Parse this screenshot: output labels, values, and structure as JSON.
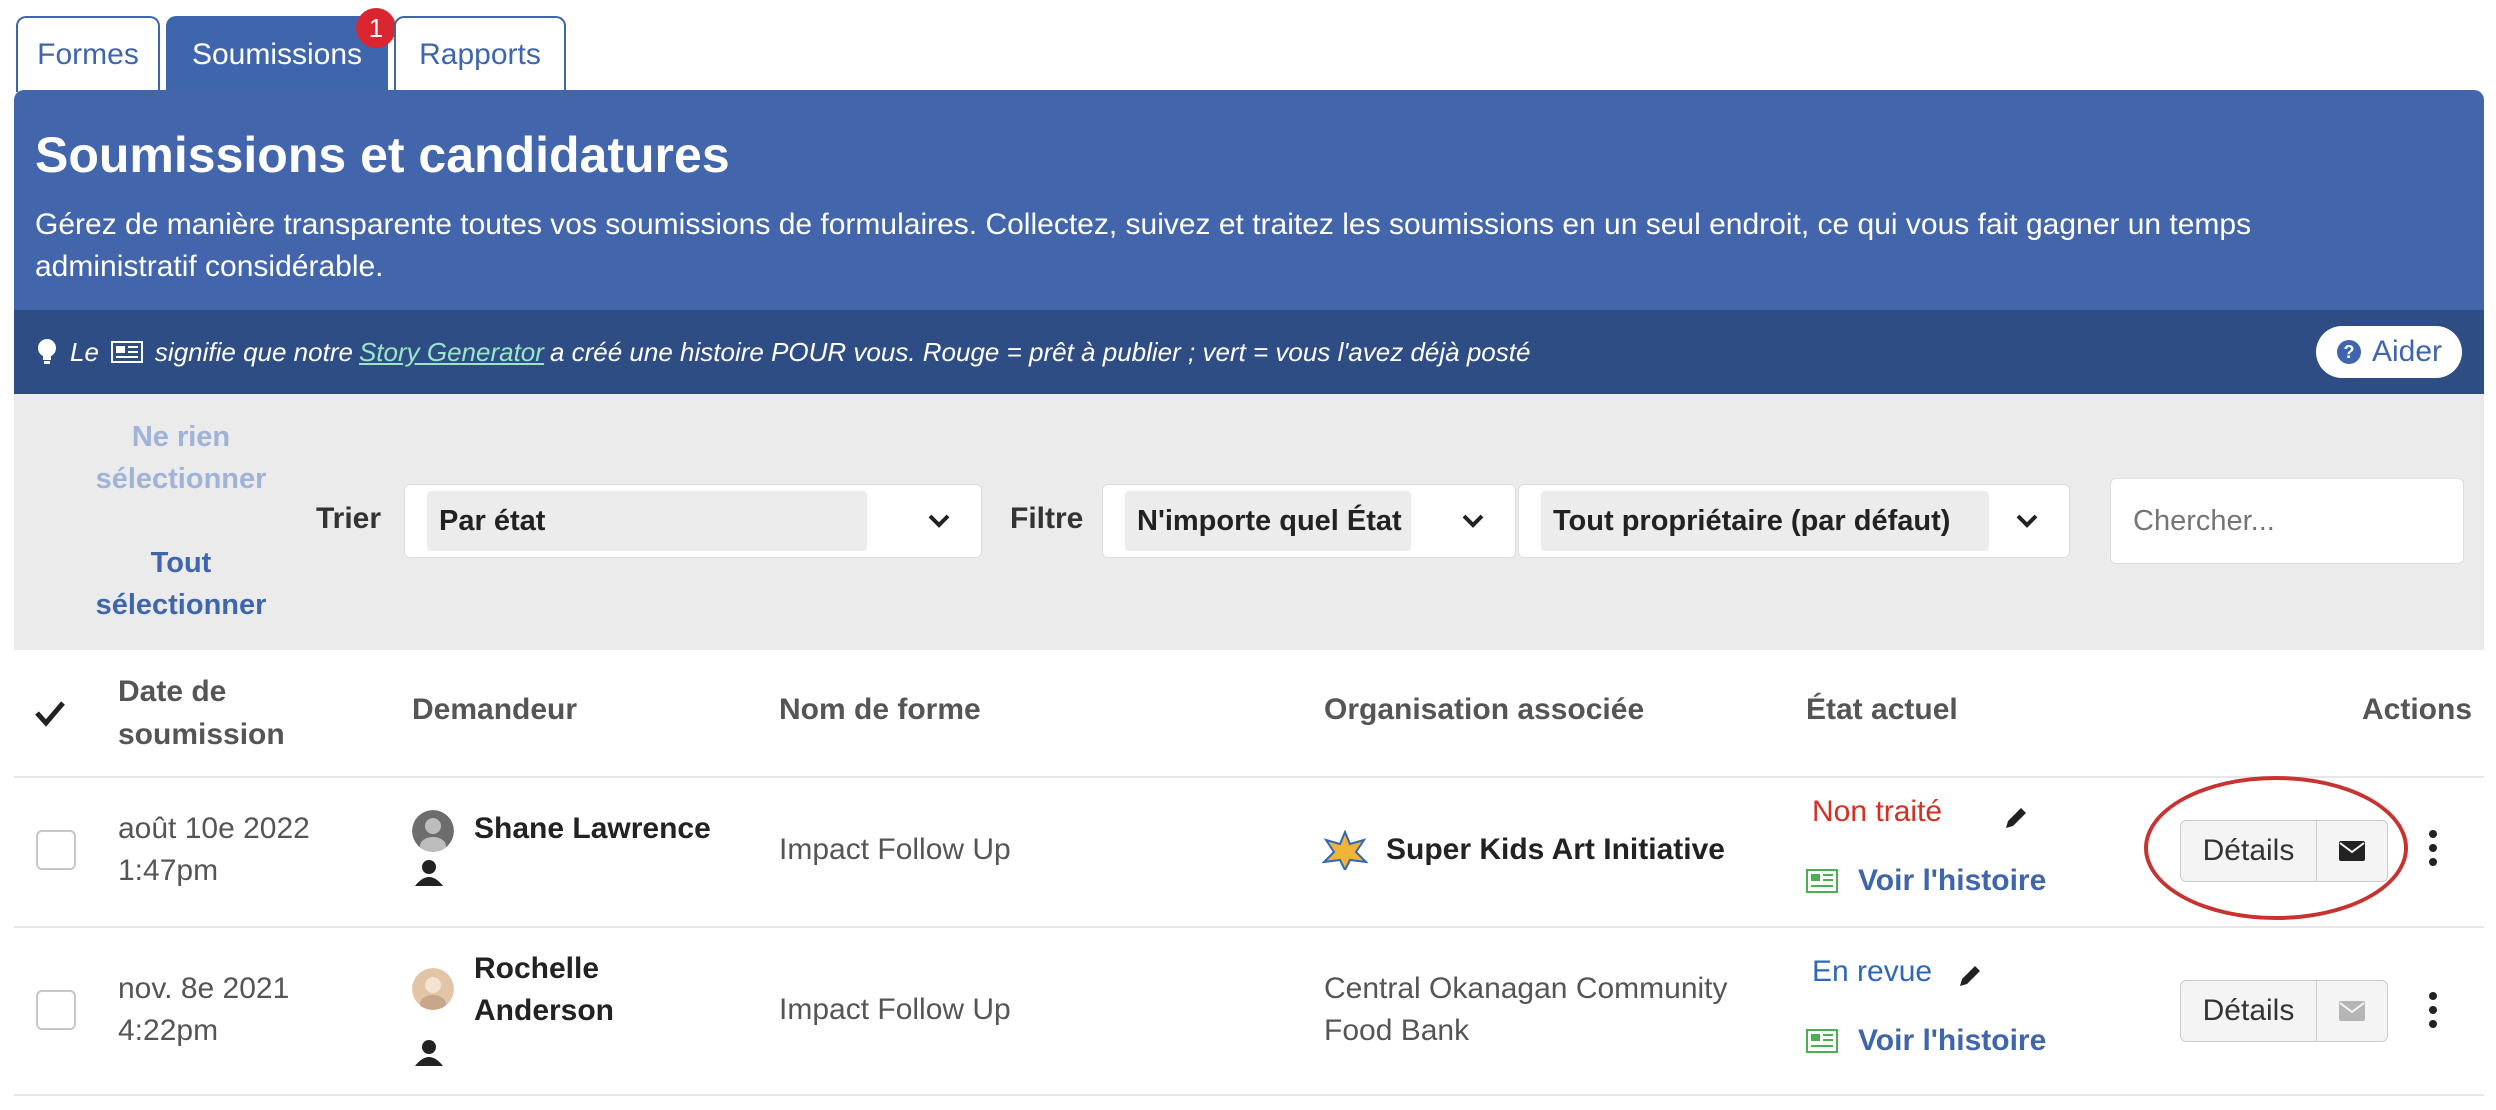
{
  "tabs": [
    {
      "label": "Formes"
    },
    {
      "label": "Soumissions",
      "badge": "1"
    },
    {
      "label": "Rapports"
    }
  ],
  "header": {
    "title": "Soumissions et candidatures",
    "description": "Gérez de manière transparente toutes vos soumissions de formulaires. Collectez, suivez et traitez les soumissions en un seul endroit, ce qui vous fait gagner un temps administratif considérable."
  },
  "tip": {
    "prefix": "Le",
    "middle": "signifie que notre",
    "link": "Story Generator",
    "suffix": "a créé une histoire POUR vous. Rouge = prêt à publier ; vert = vous l'avez déjà posté",
    "help_label": "Aider"
  },
  "filters": {
    "select_none": "Ne rien sélectionner",
    "select_all": "Tout sélectionner",
    "sort_label": "Trier",
    "sort_value": "Par état",
    "filter_label": "Filtre",
    "state_value": "N'importe quel État",
    "owner_value": "Tout propriétaire (par défaut)",
    "search_placeholder": "Chercher..."
  },
  "table": {
    "headers": {
      "date": "Date de soumission",
      "requester": "Demandeur",
      "form": "Nom de forme",
      "org": "Organisation associée",
      "state": "État actuel",
      "actions": "Actions"
    },
    "rows": [
      {
        "date": "août 10e 2022",
        "time": "1:47pm",
        "requester": "Shane Lawrence",
        "form": "Impact Follow Up",
        "org": "Super Kids Art Initiative",
        "state": "Non traité",
        "state_color": "#d42f21",
        "story": "Voir l'histoire",
        "details": "Détails"
      },
      {
        "date": "nov. 8e 2021",
        "time": "4:22pm",
        "requester": "Rochelle Anderson",
        "form": "Impact Follow Up",
        "org": "Central Okanagan Community Food Bank",
        "state": "En revue",
        "state_color": "#2f68b5",
        "story": "Voir l'histoire",
        "details": "Détails"
      }
    ]
  },
  "colors": {
    "primary": "#4265ab",
    "tipbar": "#2f4d85",
    "story_icon": "#4caf50",
    "highlight": "#c8332f"
  }
}
